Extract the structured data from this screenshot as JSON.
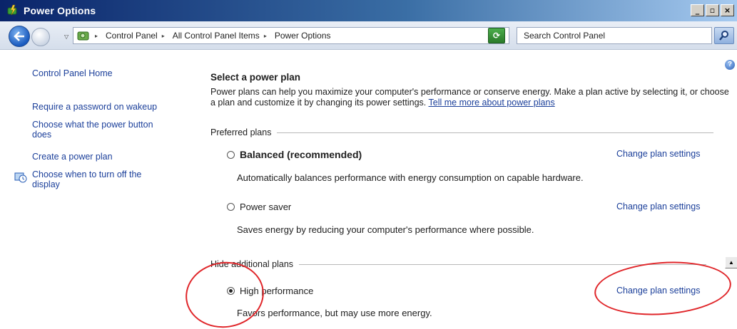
{
  "window": {
    "title": "Power Options",
    "buttons": {
      "minimize": "_",
      "maximize": "▫",
      "close": "×"
    }
  },
  "address_bar": {
    "crumbs": [
      "Control Panel",
      "All Control Panel Items",
      "Power Options"
    ],
    "search_placeholder": "Search Control Panel"
  },
  "sidebar": {
    "home": "Control Panel Home",
    "links": [
      "Require a password on wakeup",
      "Choose what the power button",
      "does",
      "Create a power plan",
      "Choose when to turn off the",
      "display"
    ]
  },
  "main": {
    "heading": "Select a power plan",
    "description": "Power plans can help you maximize your computer's performance or conserve energy. Make a plan active by selecting it, or choose a plan and customize it by changing its power settings.",
    "learn_more": "Tell me more about power plans",
    "preferred_label": "Preferred plans",
    "additional_label": "Hide additional plans",
    "change_label": "Change plan settings",
    "plans": [
      {
        "name": "Balanced (recommended)",
        "description": "Automatically balances performance with energy consumption on capable hardware.",
        "selected": false
      },
      {
        "name": "Power saver",
        "description": "Saves energy by reducing your computer's performance where possible.",
        "selected": false
      },
      {
        "name": "High performance",
        "description": "Favors performance, but may use more energy.",
        "selected": true
      }
    ]
  },
  "colors": {
    "link": "#1b3f9a",
    "annotation": "#e0262a",
    "titlebar": "#0a246a"
  }
}
